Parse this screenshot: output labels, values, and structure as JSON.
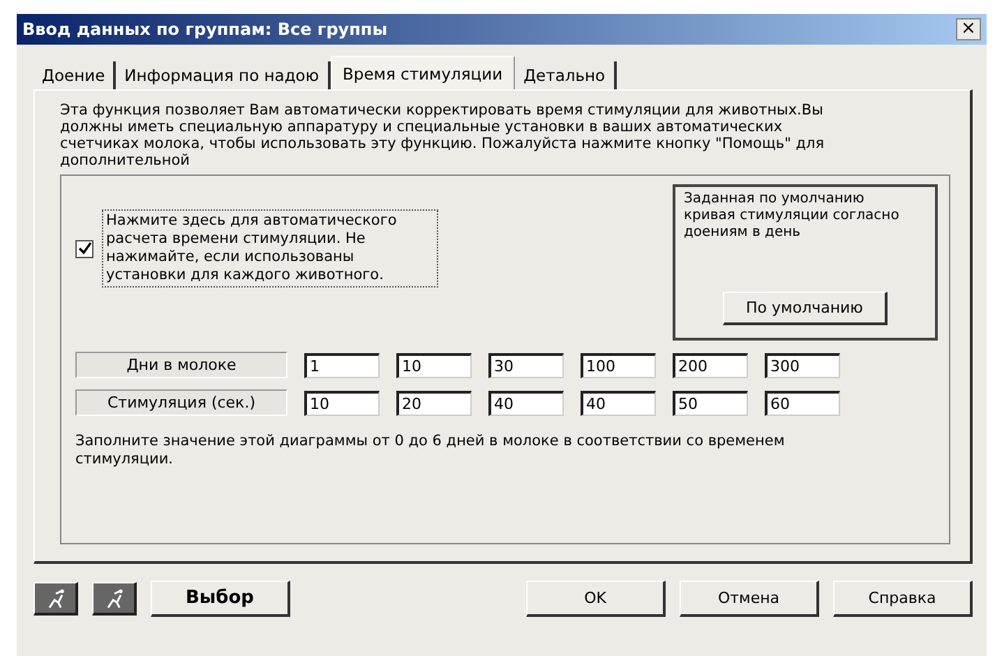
{
  "window": {
    "title": "Ввод данных по группам: Все группы",
    "close": "×"
  },
  "tabs": [
    {
      "label": "Доение",
      "selected": false
    },
    {
      "label": "Информация по надою",
      "selected": false
    },
    {
      "label": "Время стимуляции",
      "selected": true
    },
    {
      "label": "Детально",
      "selected": false
    }
  ],
  "description": "Эта функция позволяет Вам автоматически корректировать время стимуляции для животных.Вы должны иметь специальную аппаратуру и специальные установки в ваших автоматических счетчиках молока, чтобы использовать эту функцию. Пожалуйста нажмите кнопку \"Помощь\" для дополнительной",
  "auto_checkbox": {
    "label": "Нажмите здесь для автоматического расчета времени стимуляции. Не нажимайте, если использованы установки для каждого животного.",
    "checked": true
  },
  "default_box": {
    "text": "Заданная по умолчанию кривая стимуляции согласно доениям в день",
    "button": "По умолчанию"
  },
  "rows": [
    {
      "label": "Дни в молоке",
      "values": [
        "1",
        "10",
        "30",
        "100",
        "200",
        "300"
      ]
    },
    {
      "label": "Стимуляция (сек.)",
      "values": [
        "10",
        "20",
        "40",
        "40",
        "50",
        "60"
      ]
    }
  ],
  "note": "Заполните значение этой диаграммы от 0 до 6 дней в молоке в соответствии со временем стимуляции.",
  "footer": {
    "icon_buttons": [
      {
        "kind": "runner"
      },
      {
        "kind": "runner"
      }
    ],
    "select": "Выбор",
    "ok": "OK",
    "cancel": "Отмена",
    "help": "Справка"
  }
}
